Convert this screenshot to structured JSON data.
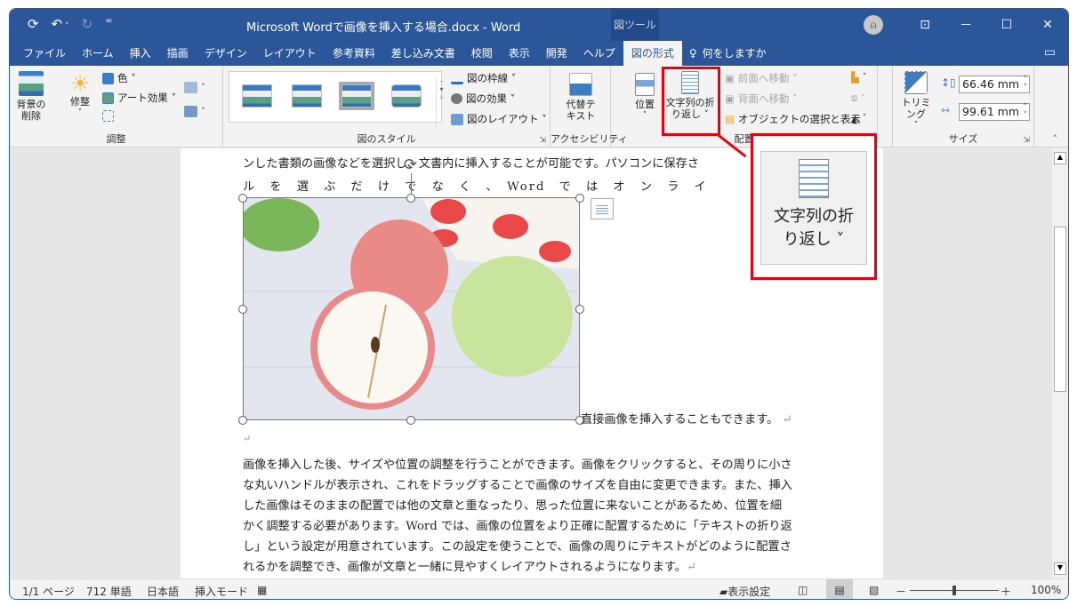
{
  "titlebar": {
    "qat": {
      "save_icon": "autosave-icon",
      "undo_icon": "undo-icon",
      "undo_dropdown": "˅",
      "redo_icon": "redo-icon",
      "customize": "="
    },
    "title": "Microsoft Wordで画像を挿入する場合.docx  -  Word",
    "context_tab": "図ツール",
    "buttons": {
      "avatar": "8",
      "ribbon_display": "⊡",
      "minimize": "－",
      "maximize": "☐",
      "close": "✕"
    }
  },
  "tabs": [
    {
      "label": "ファイル"
    },
    {
      "label": "ホーム"
    },
    {
      "label": "挿入"
    },
    {
      "label": "描画"
    },
    {
      "label": "デザイン"
    },
    {
      "label": "レイアウト"
    },
    {
      "label": "参考資料"
    },
    {
      "label": "差し込み文書"
    },
    {
      "label": "校閲"
    },
    {
      "label": "表示"
    },
    {
      "label": "開発"
    },
    {
      "label": "ヘルプ"
    },
    {
      "label": "図の形式",
      "active": true
    }
  ],
  "tellme": {
    "icon": "lightbulb-icon",
    "label": "何をしますか"
  },
  "ribbon": {
    "adjust": {
      "label": "調整",
      "remove_bg": "背景の\n削除",
      "corrections": "修整",
      "color": "色 ˅",
      "artistic": "アート効果 ˅"
    },
    "styles": {
      "label": "図のスタイル",
      "border": "図の枠線 ˅",
      "effects": "図の効果 ˅",
      "layout": "図のレイアウト ˅"
    },
    "accessibility": {
      "label": "アクセシビリティ",
      "alt_text_1": "代替テ",
      "alt_text_2": "キスト"
    },
    "arrange": {
      "label": "配置",
      "position": "位置",
      "wrap_1": "文字列の折",
      "wrap_2": "り返し ˅",
      "bring_forward": "前面へ移動  ˅",
      "send_backward": "背面へ移動  ˅",
      "selection_pane": "オブジェクトの選択と表示"
    },
    "size": {
      "label": "サイズ",
      "crop": "トリミング",
      "height": "66.46 mm",
      "width": "99.61 mm"
    }
  },
  "callout": {
    "label_1": "文字列の折",
    "label_2": "り返し ˅"
  },
  "document": {
    "line1": "ンした書類の画像などを選択し、文書内に挿入することが可能です。パソコンに保存さ",
    "line2": "ル　を　選　ぶ　だ　け　で　な　く　、　Word　で　は　オ　ン　ラ　イ",
    "line3": "直接画像を挿入することもできます。",
    "para": [
      "画像を挿入した後、サイズや位置の調整を行うことができます。画像をクリックすると、その周りに小さ",
      "な丸いハンドルが表示され、これをドラッグすることで画像のサイズを自由に変更できます。また、挿入",
      "した画像はそのままの配置では他の文章と重なったり、思った位置に来ないことがあるため、位置を細",
      "かく調整する必要があります。Word では、画像の位置をより正確に配置するために「テキストの折り返",
      "し」という設定が用意されています。この設定を使うことで、画像の周りにテキストがどのように配置さ",
      "れるかを調整でき、画像が文章と一緒に見やすくレイアウトされるようになります。"
    ],
    "return_mark": "↵"
  },
  "status": {
    "page": "1/1 ページ",
    "words": "712 単語",
    "language": "日本語",
    "mode": "挿入モード",
    "display_settings": "表示設定",
    "zoom": "100%",
    "zoom_minus": "－",
    "zoom_plus": "＋"
  }
}
